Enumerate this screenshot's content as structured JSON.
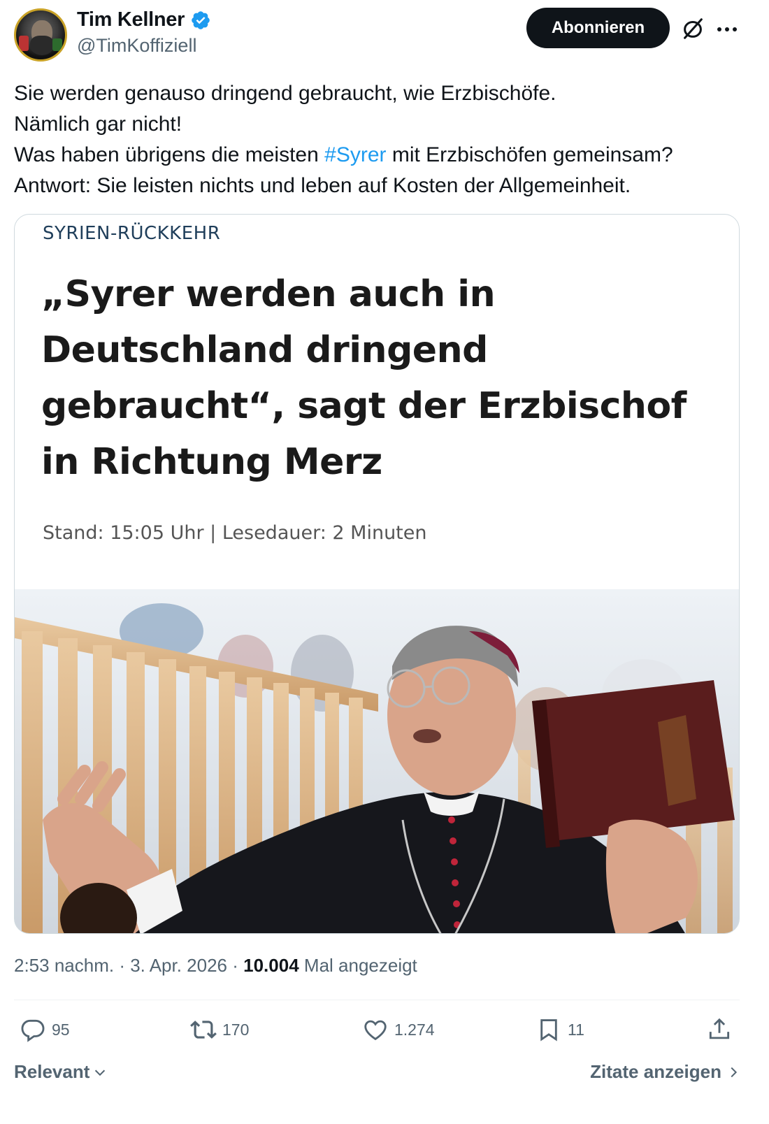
{
  "author": {
    "display_name": "Tim Kellner",
    "handle": "@TimKoffiziell",
    "verified": true
  },
  "header": {
    "subscribe_label": "Abonnieren",
    "grok_icon": "grok-slash-icon",
    "more_icon": "more-dots-icon"
  },
  "tweet": {
    "lines": [
      "Sie werden genauso dringend gebraucht, wie Erzbischöfe.",
      "Nämlich gar nicht!",
      "Was haben übrigens die meisten ",
      "#Syrer",
      " mit Erzbischöfen gemeinsam?",
      "Antwort: Sie leisten nichts und leben auf Kosten der Allgemeinheit."
    ]
  },
  "card": {
    "kicker": "SYRIEN-RÜCKKEHR",
    "headline_lines": [
      "„Syrer werden auch in",
      "Deutschland dringend",
      "gebraucht“, sagt der Erzbischof",
      "in Richtung Merz"
    ],
    "meta": "Stand: 15:05 Uhr  |  Lesedauer: 2 Minuten"
  },
  "footer": {
    "time": "2:53 nachm.",
    "date": "3. Apr. 2026",
    "views": "10.004",
    "views_label": "Mal angezeigt"
  },
  "actions": {
    "replies": "95",
    "reposts": "170",
    "likes": "1.274",
    "bookmarks": "11"
  },
  "bottom": {
    "sort_label": "Relevant",
    "quotes_label": "Zitate anzeigen"
  },
  "colors": {
    "link": "#1d9bf0",
    "text": "#0f1419",
    "secondary": "#536471",
    "verified": "#1d9bf0"
  }
}
